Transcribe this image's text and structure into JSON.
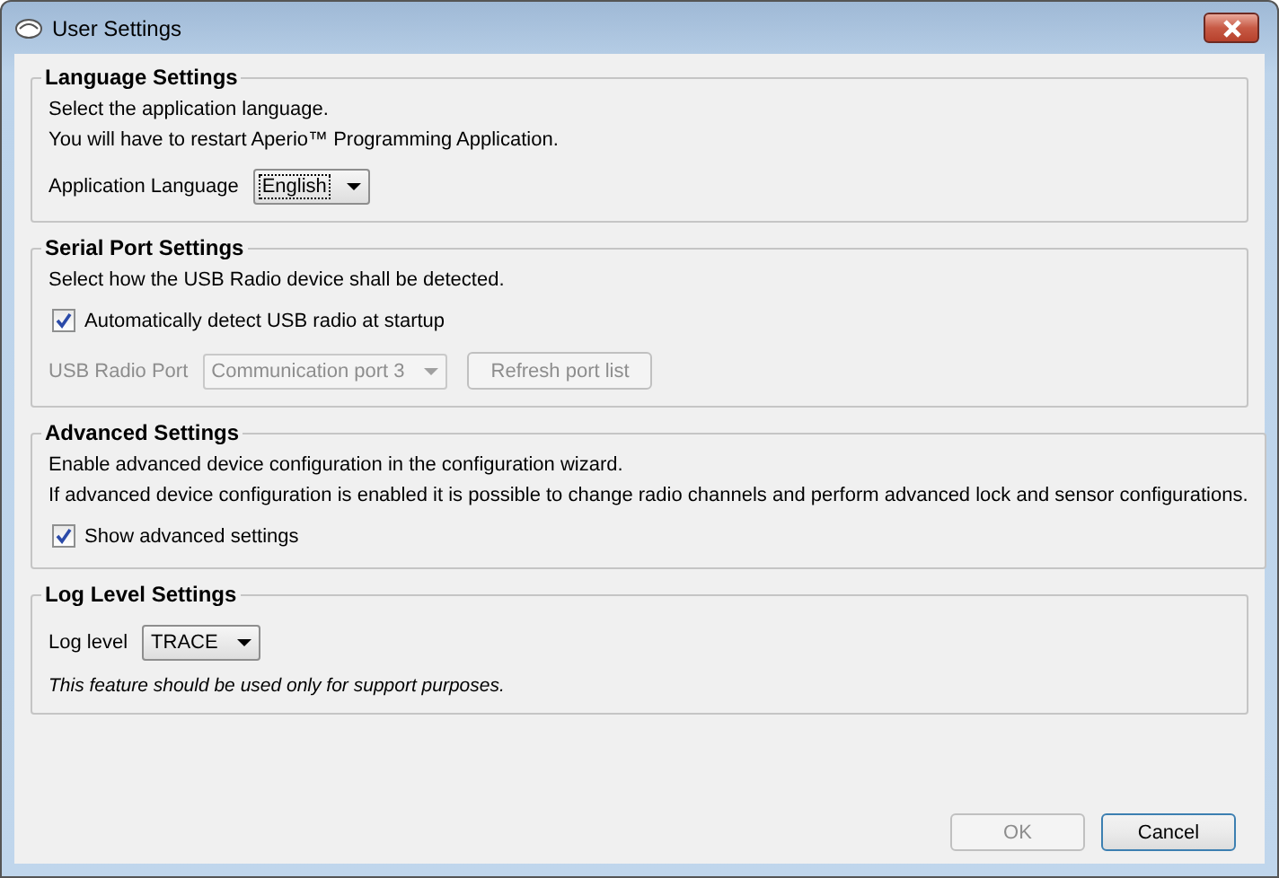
{
  "window": {
    "title": "User Settings"
  },
  "sections": [
    {
      "title": "Language Settings",
      "rows": [
        {
          "kind": "text",
          "text": "Select the application language."
        },
        {
          "kind": "text",
          "text": "You will have to restart Aperio™ Programming Application."
        },
        {
          "kind": "select",
          "label": "Application Language",
          "value": "English",
          "disabled": false,
          "focused": true
        }
      ]
    },
    {
      "title": "Serial Port Settings",
      "rows": [
        {
          "kind": "text",
          "text": "Select how the USB Radio device shall be detected."
        },
        {
          "kind": "checkbox",
          "label": "Automatically detect USB radio at startup",
          "checked": true
        },
        {
          "kind": "select",
          "label": "USB Radio Port",
          "value": "Communication port 3",
          "disabled": true,
          "focused": false,
          "button": {
            "label": "Refresh port list",
            "disabled": true
          }
        }
      ]
    },
    {
      "title": "Advanced Settings",
      "rows": [
        {
          "kind": "text",
          "text": "Enable advanced device configuration in the configuration wizard."
        },
        {
          "kind": "text",
          "text": "If advanced device configuration is enabled it is possible to change radio channels and perform advanced lock and sensor configurations."
        },
        {
          "kind": "checkbox",
          "label": "Show advanced settings",
          "checked": true
        }
      ]
    },
    {
      "title": "Log Level Settings",
      "rows": [
        {
          "kind": "select",
          "label": "Log level",
          "value": "TRACE",
          "disabled": false,
          "focused": false
        },
        {
          "kind": "note",
          "text": "This feature should be used only for support purposes."
        }
      ]
    }
  ],
  "buttons": [
    {
      "label": "OK",
      "disabled": true
    },
    {
      "label": "Cancel",
      "disabled": false
    }
  ]
}
